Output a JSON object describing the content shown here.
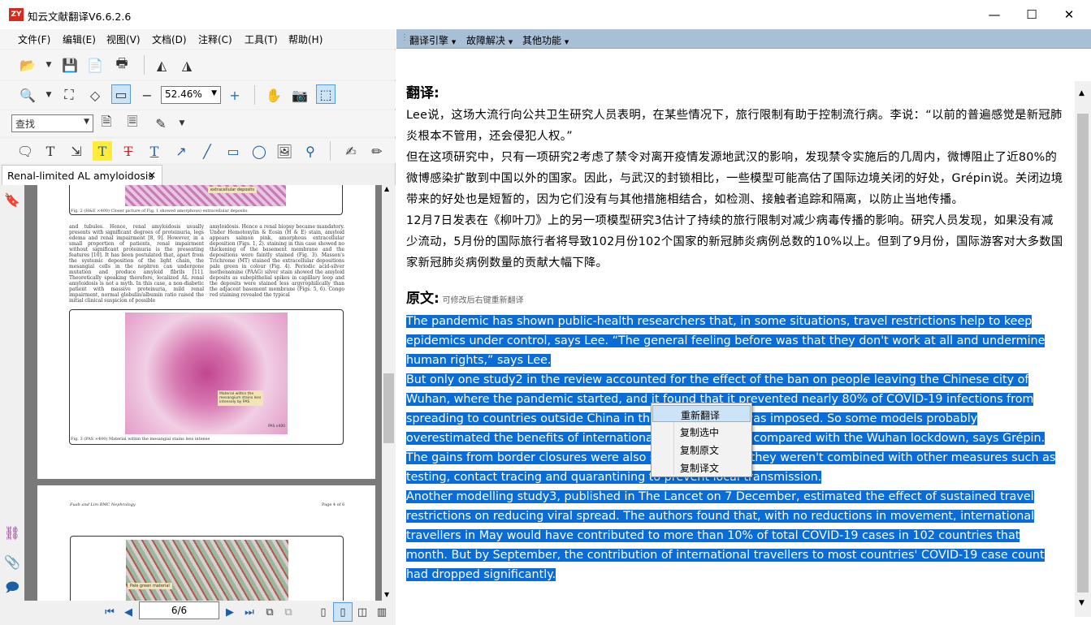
{
  "window": {
    "title": "知云文献翻译V6.6.2.6",
    "logo_text": "ZY",
    "minimize": "—",
    "maximize": "☐",
    "close": "✕"
  },
  "menu": [
    "文件(F)",
    "编辑(E)",
    "视图(V)",
    "文档(D)",
    "注释(C)",
    "工具(T)",
    "帮助(H)"
  ],
  "toolbar": {
    "zoom_value": "52.46%",
    "find_placeholder": "查找"
  },
  "document": {
    "tab_label": "Renal-limited AL amyloidosis",
    "tab_close": "✕",
    "fig2_caption": "Fig. 2 (H&E ×400) Closer picture of Fig. 1 showed amorphous) extracellular deposits",
    "fig2_label": "extracellular deposits",
    "col1_text": "and tubules. Hence, renal amyloidosis usually presents with significant degrees of proteinuria, legs edema and renal impairment [8, 9]. However, in a small proportion of patients, renal impairment without significant proteinuria is the presenting features [10]. It has been postulated that, apart from the systemic deposition of the light chain, the mesangial cells in the nephron can undergone mutation and produce amyloid fibrils [11]. Theoretically speaking therefore, localized AL renal amyloidosis is not a myth. In this case, a non-diabetic patient with massive proteinuria, mild renal impairment, normal globulin/albumin ratio raised the initial clinical suspicion of possible",
    "col2_text": "amyloidosis. Hence a renal biopsy became mandatory. Under Hemotoxylin & Eosin (H & E) stain, amyloid appears salmon pink, amorphous extracellular deposition (Figs. 1, 2). staining in this case showed no thickening of the basement membrane and the depositions were faintly stained (Fig. 3). Masson's Trichrome (MT) stained the extracellular depositions pale green in colour (Fig. 4). Periodic acid-silver methenamine (PAAG) silver stain showed the amyloid deposits as subepithelial spikes in capillary loop and the deposits were stained less argyrophilically than the adjacent basement membrane (Figs. 5, 6). Congo red staining revealed the typical",
    "fig3_note": "Material within the mesangium stains less intensely by PAS",
    "fig3_mag": "PAS x400",
    "fig3_caption": "Fig. 3 (PAS ×400) Material within the mesangial stains less intense",
    "page2_header_left": "Fuah and Lim BMC Nephrology",
    "page2_header_right": "Page 4 of 6",
    "fig4_label": "Pale green material",
    "page_indicator": "6/6"
  },
  "translation_panel": {
    "menus": [
      "翻译引擎",
      "故障解决",
      "其他功能"
    ],
    "translation_heading": "翻译:",
    "translation_paragraphs": [
      "Lee说，这场大流行向公共卫生研究人员表明，在某些情况下，旅行限制有助于控制流行病。李说：“以前的普遍感觉是新冠肺炎根本不管用，还会侵犯人权。”",
      "但在这项研究中，只有一项研究2考虑了禁令对离开疫情发源地武汉的影响，发现禁令实施后的几周内，微博阻止了近80%的微博感染扩散到中国以外的国家。因此，与武汉的封锁相比，一些模型可能高估了国际边境关闭的好处，Grépin说。关闭边境带来的好处也是短暂的，因为它们没有与其他措施相结合，如检测、接触者追踪和隔离，以防止当地传播。",
      "12月7日发表在《柳叶刀》上的另一项模型研究3估计了持续的旅行限制对减少病毒传播的影响。研究人员发现，如果没有减少流动，5月份的国际旅行者将导致102月份102个国家的新冠肺炎病例总数的10%以上。但到了9月份，国际游客对大多数国家新冠肺炎病例数量的贡献大幅下降。"
    ],
    "original_heading": "原文:",
    "original_hint": "可修改后右键重新翻译",
    "original_paragraphs": [
      "The pandemic has shown public-health researchers that, in some situations, travel restrictions help to keep epidemics under control, says Lee. “The general feeling before was that they don't work at all and undermine human rights,” says Lee.",
      "But only one study2 in the review accounted for the effect of the ban on people leaving the Chinese city of Wuhan, where the pandemic started, and it found that it prevented nearly 80% of COVID-19 infections from spreading to countries outside China in the weeks after it was imposed. So some models probably overestimated the benefits of international border closures compared with the Wuhan lockdown, says Grépin. The gains from border closures were also short-lived when they weren't combined with other measures such as testing, contact tracing and quarantining to prevent local transmission.",
      "Another modelling study3, published in The Lancet on 7 December, estimated the effect of sustained travel restrictions on reducing viral spread. The authors found that, with no reductions in movement, international travellers in May would have contributed to more than 10% of total COVID-19 cases in 102 countries that month. But by September, the contribution of international travellers to most countries' COVID-19 case count had dropped significantly."
    ]
  },
  "context_menu": [
    "重新翻译",
    "复制选中",
    "复制原文",
    "复制译文"
  ]
}
